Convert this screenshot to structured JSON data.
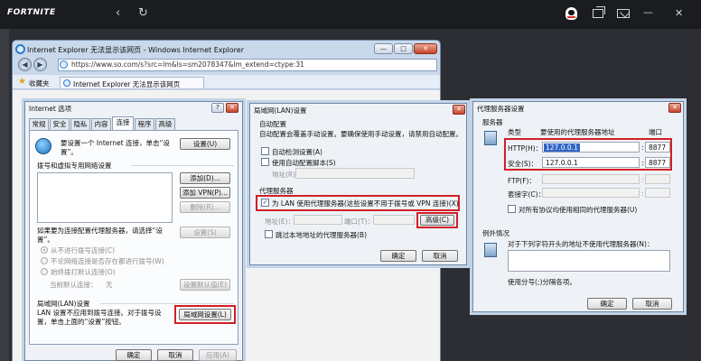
{
  "launcher": {
    "logo": "FORTNITE",
    "back_glyph": "‹",
    "reload_glyph": "↻",
    "right_icons": [
      "qq-penguin-icon",
      "window-switch-icon",
      "mail-icon"
    ],
    "min_glyph": "—",
    "close_glyph": "✕"
  },
  "ie": {
    "window_title": "Internet Explorer 无法显示该网页 - Windows Internet Explorer",
    "address": "https://www.so.com/s?src=lm&ls=sm2078347&lm_extend=ctype:31",
    "favorites_label": "收藏夹",
    "tab_title": "Internet Explorer 无法显示该网页"
  },
  "internet_options": {
    "title": "Internet 选项",
    "help_glyph": "?",
    "close_glyph": "✕",
    "tabs": [
      "常规",
      "安全",
      "隐私",
      "内容",
      "连接",
      "程序",
      "高级"
    ],
    "active_tab": "连接",
    "setup_text": "要设置一个 Internet 连接，单击“设置”。",
    "setup_button": "设置(U)",
    "dialup_group": "拨号和虚拟专用网络设置",
    "add_button": "添加(D)...",
    "add_vpn_button": "添加 VPN(P)...",
    "remove_button": "删除(R)...",
    "settings_button": "设置(S)",
    "proxy_hint": "如果要为连接配置代理服务器，请选择“设置”。",
    "radio_never": "从不进行拨号连接(C)",
    "radio_no_network": "不论网络连接是否存在都进行拨号(W)",
    "radio_always": "始终拨打默认连接(O)",
    "current_default_label": "当前默认连接：",
    "current_default_value": "无",
    "set_default_button": "设置默认值(E)",
    "lan_group": "局域网(LAN)设置",
    "lan_text": "LAN 设置不应用到拨号连接。对于拨号设置，单击上面的“设置”按钮。",
    "lan_button": "局域网设置(L)",
    "ok": "确定",
    "cancel": "取消",
    "apply": "应用(A)"
  },
  "lan_settings": {
    "title": "局域网(LAN)设置",
    "close_glyph": "✕",
    "auto_group": "自动配置",
    "auto_text": "自动配置会覆盖手动设置。要确保使用手动设置，请禁用自动配置。",
    "auto_detect": "自动检测设置(A)",
    "use_script": "使用自动配置脚本(S)",
    "address_label": "地址(R)",
    "proxy_group": "代理服务器",
    "use_proxy": "为 LAN 使用代理服务器(这些设置不用于拨号或 VPN 连接)(X)",
    "addr_label": "地址(E)：",
    "port_label": "端口(T)：",
    "advanced_button": "高级(C)",
    "bypass_local": "跳过本地地址的代理服务器(B)",
    "check_mark": "✓",
    "ok": "确定",
    "cancel": "取消"
  },
  "proxy_settings": {
    "title": "代理服务器设置",
    "close_glyph": "✕",
    "servers_group": "服务器",
    "col_type": "类型",
    "col_address": "要使用的代理服务器地址",
    "col_port": "端口",
    "rows": [
      {
        "type": "HTTP(H)：",
        "address": "127.0.0.1",
        "port": "8877"
      },
      {
        "type": "安全(S)：",
        "address": "127.0.0.1",
        "port": "8877"
      },
      {
        "type": "FTP(F)：",
        "address": "",
        "port": ""
      },
      {
        "type": "套接字(C)：",
        "address": "",
        "port": ""
      }
    ],
    "same_for_all": "对所有协议均使用相同的代理服务器(U)",
    "exceptions_group": "例外情况",
    "exceptions_text": "对于下列字符开头的地址不使用代理服务器(N)：",
    "separator_hint": "使用分号(;)分隔各项。",
    "ok": "确定",
    "cancel": "取消"
  }
}
